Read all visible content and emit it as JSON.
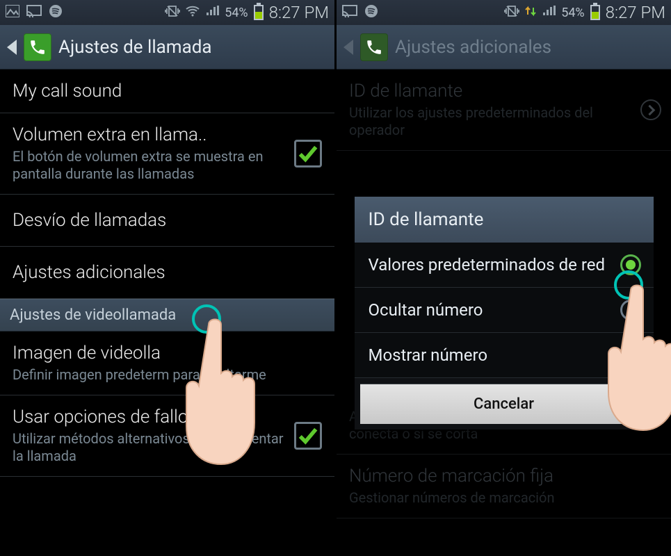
{
  "status": {
    "battery_pct": "54%",
    "clock": "8:27 PM"
  },
  "left": {
    "title": "Ajustes de llamada",
    "items": {
      "my_call_sound": "My call sound",
      "extra_volume_title": "Volumen extra en llama..",
      "extra_volume_sub": "El botón de volumen extra se muestra en pantalla durante las llamadas",
      "call_forwarding": "Desvío de llamadas",
      "additional_settings": "Ajustes adicionales",
      "video_section": "Ajustes de videollamada",
      "video_image_title": "Imagen de videolla",
      "video_image_sub": "Definir imagen predeterm              para ocultarme",
      "fallback_title": "Usar opciones de fallo d..",
      "fallback_sub": "Utilizar métodos alternativos para reintentar la llamada"
    }
  },
  "right": {
    "title": "Ajustes adicionales",
    "bg": {
      "caller_id_title": "ID de llamante",
      "caller_id_sub": "Utilizar los ajustes predeterminados del operador",
      "auto_redial_sub": "Activar rellamada automática si la llamada no se conecta o si se corta",
      "fdn_title": "Número de marcación fija",
      "fdn_sub": "Gestionar números de marcación"
    },
    "dialog": {
      "title": "ID de llamante",
      "opt_default": "Valores predeterminados de red",
      "opt_hide": "Ocultar número",
      "opt_show": "Mostrar número",
      "cancel": "Cancelar"
    }
  }
}
